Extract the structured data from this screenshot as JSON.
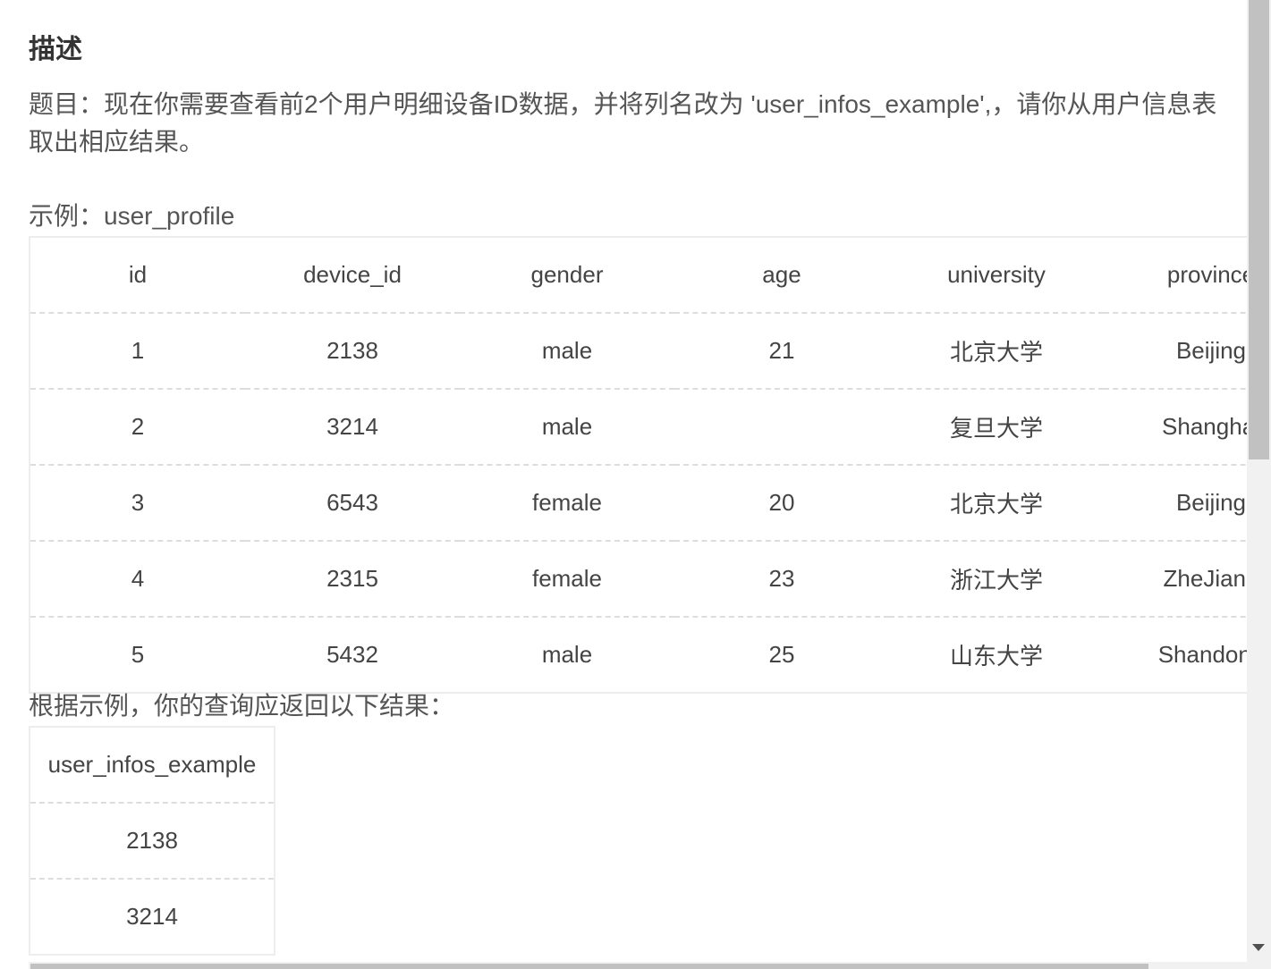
{
  "description": {
    "heading": "描述",
    "problem_text": "题目：现在你需要查看前2个用户明细设备ID数据，并将列名改为 'user_infos_example',，请你从用户信息表取出相应结果。"
  },
  "example": {
    "label": "示例：user_profile",
    "columns": [
      "id",
      "device_id",
      "gender",
      "age",
      "university",
      "province"
    ],
    "rows": [
      [
        "1",
        "2138",
        "male",
        "21",
        "北京大学",
        "Beijing"
      ],
      [
        "2",
        "3214",
        "male",
        "",
        "复旦大学",
        "Shanghai"
      ],
      [
        "3",
        "6543",
        "female",
        "20",
        "北京大学",
        "Beijing"
      ],
      [
        "4",
        "2315",
        "female",
        "23",
        "浙江大学",
        "ZheJiang"
      ],
      [
        "5",
        "5432",
        "male",
        "25",
        "山东大学",
        "Shandong"
      ]
    ]
  },
  "result": {
    "label": "根据示例，你的查询应返回以下结果：",
    "columns": [
      "user_infos_example"
    ],
    "rows": [
      [
        "2138"
      ],
      [
        "3214"
      ]
    ]
  },
  "scrollbars": {
    "vertical_position": 0,
    "horizontal_position": 0
  }
}
